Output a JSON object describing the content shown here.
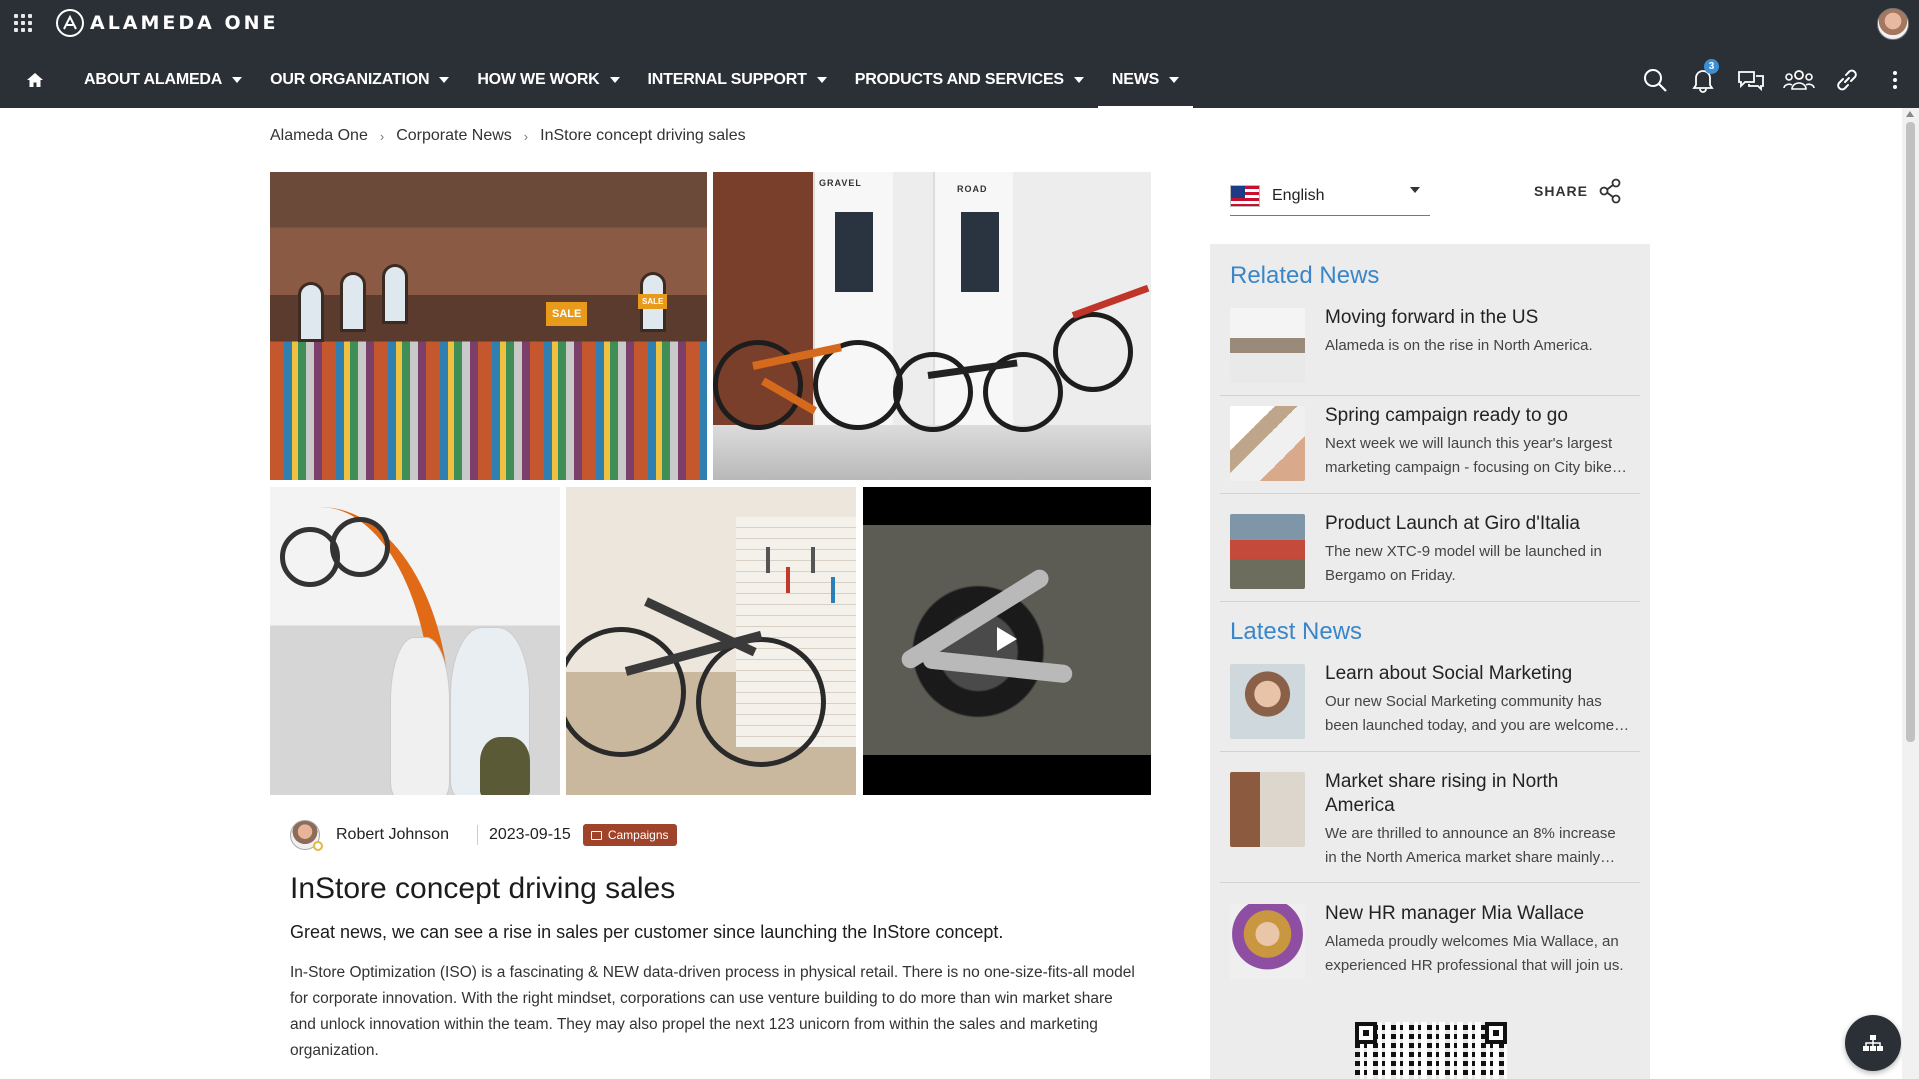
{
  "app": {
    "logo_text": "ALAMEDA ONE"
  },
  "nav": {
    "items": [
      {
        "label": "ABOUT ALAMEDA"
      },
      {
        "label": "OUR ORGANIZATION"
      },
      {
        "label": "HOW WE WORK"
      },
      {
        "label": "INTERNAL SUPPORT"
      },
      {
        "label": "PRODUCTS AND SERVICES"
      },
      {
        "label": "NEWS"
      }
    ],
    "active": "NEWS",
    "notification_count": "3"
  },
  "breadcrumb": [
    "Alameda One",
    "Corporate News",
    "InStore concept driving sales"
  ],
  "gallery": {
    "sale_sign": "SALE",
    "tag_gravel": "GRAVEL",
    "tag_road": "ROAD"
  },
  "article": {
    "author": "Robert Johnson",
    "date": "2023-09-15",
    "category": "Campaigns",
    "title": "InStore concept driving sales",
    "lead": "Great news, we can see a rise in sales per customer since launching the InStore concept.",
    "body": "In-Store Optimization (ISO) is a fascinating & NEW data-driven process in physical retail. There is no one-size-fits-all model for corporate innovation. With the right mindset, corporations can use venture building to do more than win market share and unlock innovation within the team. They may also propel the next 123 unicorn from within the sales and marketing organization."
  },
  "language": {
    "selected": "English"
  },
  "share_label": "SHARE",
  "related": {
    "title": "Related News",
    "items": [
      {
        "title": "Moving forward in the US",
        "desc": "Alameda is on the rise in North America."
      },
      {
        "title": "Spring campaign ready to go",
        "desc": "Next week we will launch this year's largest marketing campaign - focusing on City bikes and urban commuting."
      },
      {
        "title": "Product Launch at Giro d'Italia",
        "desc": "The new XTC-9 model will be launched in Bergamo on Friday."
      }
    ]
  },
  "latest": {
    "title": "Latest News",
    "items": [
      {
        "title": "Learn about Social Marketing",
        "desc": "Our new Social Marketing community has been launched today, and you are welcome to join."
      },
      {
        "title": "Market share rising in North America",
        "desc": "We are thrilled to announce an 8% increase in the North America market share mainly driven by sales."
      },
      {
        "title": "New HR manager Mia Wallace",
        "desc": "Alameda proudly welcomes Mia Wallace, an experienced HR professional that will join us."
      }
    ]
  },
  "colors": {
    "topbar": "#2b3036",
    "accent": "#3a86c8",
    "tag": "#a0432b",
    "badge": "#3a8fd6"
  }
}
